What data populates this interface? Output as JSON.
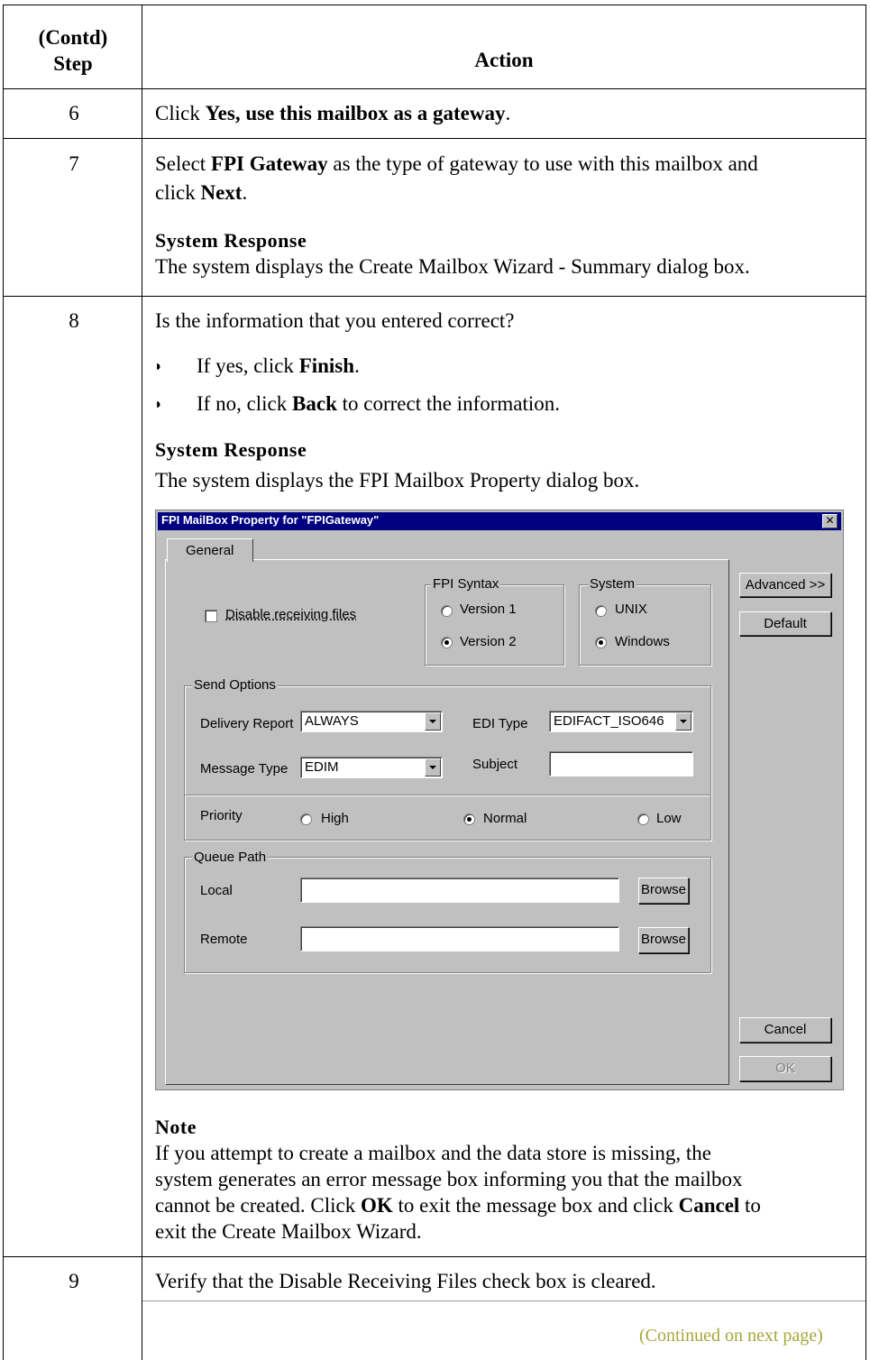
{
  "table": {
    "header": {
      "step_line1": "(Contd)",
      "step_line2": "Step",
      "action": "Action"
    },
    "rows": [
      {
        "step": "6",
        "text_pre": "Click ",
        "text_bold": "Yes, use this mailbox as a gateway",
        "text_post": "."
      },
      {
        "step": "7",
        "line1_pre": "Select ",
        "line1_bold": "FPI Gateway",
        "line1_post": " as the type of gateway to use with this mailbox and",
        "line2_pre": "click ",
        "line2_bold": "Next",
        "line2_post": ".",
        "response_heading": "System Response",
        "response_text": "The system displays the Create Mailbox Wizard - Summary dialog box."
      },
      {
        "step": "8",
        "question": "Is the information that you entered correct?",
        "bullet1_pre": "If yes, click ",
        "bullet1_bold": "Finish",
        "bullet1_post": ".",
        "bullet2_pre": "If no, click ",
        "bullet2_bold": "Back",
        "bullet2_post": " to correct the information.",
        "response_heading": "System Response",
        "response_text": "The system displays the FPI Mailbox Property dialog box.",
        "note_heading": "Note",
        "note_line1": "If you attempt to create a mailbox and the data store is missing, the",
        "note_line2": "system generates an error message box informing you that the mailbox",
        "note_line3_pre": "cannot be created. Click ",
        "note_line3_b1": "OK",
        "note_line3_mid": " to exit the message box and click ",
        "note_line3_b2": "Cancel",
        "note_line3_post": " to",
        "note_line4": "exit the Create Mailbox Wizard."
      },
      {
        "step": "9",
        "text": "Verify that the Disable Receiving Files check box is cleared."
      }
    ],
    "continued": "(Continued on next page)"
  },
  "dialog": {
    "title": "FPI MailBox Property for \"FPIGateway\"",
    "close": "✕",
    "tab": "General",
    "disable_receiving": "Disable receiving files",
    "fpi_syntax": {
      "label": "FPI Syntax",
      "opt1": "Version 1",
      "opt2": "Version 2"
    },
    "system": {
      "label": "System",
      "opt1": "UNIX",
      "opt2": "Windows"
    },
    "send_options": {
      "label": "Send Options",
      "delivery_report_label": "Delivery Report",
      "delivery_report_value": "ALWAYS",
      "message_type_label": "Message Type",
      "message_type_value": "EDIM",
      "edi_type_label": "EDI Type",
      "edi_type_value": "EDIFACT_ISO646",
      "subject_label": "Subject",
      "subject_value": "",
      "priority_label": "Priority",
      "priority_high": "High",
      "priority_normal": "Normal",
      "priority_low": "Low"
    },
    "queue_path": {
      "label": "Queue Path",
      "local": "Local",
      "remote": "Remote",
      "browse": "Browse"
    },
    "buttons": {
      "advanced": "Advanced >>",
      "default": "Default",
      "cancel": "Cancel",
      "ok": "OK"
    }
  }
}
